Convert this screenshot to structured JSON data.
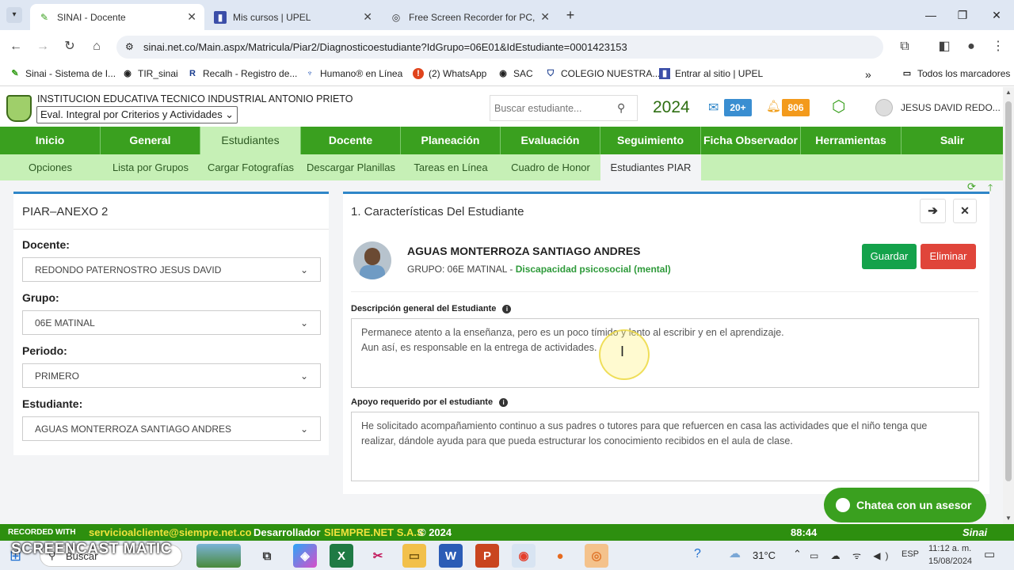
{
  "browser": {
    "tabs": [
      {
        "title": "SINAI - Docente",
        "active": true
      },
      {
        "title": "Mis cursos | UPEL",
        "active": false
      },
      {
        "title": "Free Screen Recorder for PC, M",
        "active": false
      }
    ],
    "url": "sinai.net.co/Main.aspx/Matricula/Piar2/Diagnosticoestudiante?IdGrupo=06E01&IdEstudiante=0001423153",
    "bookmarks": [
      "Sinai - Sistema de I...",
      "TIR_sinai",
      "Recalh - Registro de...",
      "Humano® en Línea",
      "(2) WhatsApp",
      "SAC",
      "COLEGIO NUESTRA...",
      "Entrar al sitio | UPEL"
    ],
    "all_bookmarks": "Todos los marcadores"
  },
  "header": {
    "institution": "INSTITUCION EDUCATIVA TECNICO INDUSTRIAL ANTONIO PRIETO",
    "mode_select": "Eval. Integral por Criterios y Actividades",
    "search_placeholder": "Buscar estudiante...",
    "year": "2024",
    "mail_badge": "20+",
    "notif_badge": "806",
    "user": "JESUS DAVID REDO..."
  },
  "menu": [
    "Inicio",
    "General",
    "Estudiantes",
    "Docente",
    "Planeación",
    "Evaluación",
    "Seguimiento",
    "Ficha Observador",
    "Herramientas",
    "Salir"
  ],
  "submenu": [
    "Opciones",
    "Lista por Grupos",
    "Cargar Fotografías",
    "Descargar Planillas",
    "Tareas en Línea",
    "Cuadro de Honor",
    "Estudiantes PIAR"
  ],
  "left_panel": {
    "title": "PIAR–ANEXO 2",
    "docente_label": "Docente:",
    "docente": "REDONDO PATERNOSTRO JESUS DAVID",
    "grupo_label": "Grupo:",
    "grupo": "06E MATINAL",
    "periodo_label": "Periodo:",
    "periodo": "PRIMERO",
    "estudiante_label": "Estudiante:",
    "estudiante": "AGUAS MONTERROZA SANTIAGO ANDRES"
  },
  "right_panel": {
    "title": "1. Características Del Estudiante",
    "student_name": "AGUAS MONTERROZA SANTIAGO ANDRES",
    "group_prefix": "GRUPO: 06E MATINAL - ",
    "disability": "Discapacidad psicosocial (mental)",
    "save": "Guardar",
    "delete": "Eliminar",
    "desc_label": "Descripción general del Estudiante",
    "desc_line1": "Permanece atento a la enseñanza, pero es un poco tímido y lento al escribir y en el aprendizaje.",
    "desc_line2": "Aun así, es responsable en la entrega de actividades.",
    "support_label": "Apoyo requerido por el estudiante",
    "support_line1": "He solicitado acompañamiento continuo a sus padres o tutores para que refuercen en casa las actividades que el niño tenga que",
    "support_line2": "realizar, dándole ayuda para que pueda estructurar los conocimiento recibidos en el aula de clase."
  },
  "chat": "Chatea con un asesor",
  "footer": {
    "recorded": "RECORDED WITH",
    "email": "servicioalcliente@siempre.net.co",
    "dev_label": "Desarrollador",
    "dev": "SIEMPRE.NET S.A.S",
    "copy": "© 2024",
    "counter": "88:44",
    "brand": "Sinai"
  },
  "watermark": "SCREENCAST MATIC",
  "taskbar": {
    "search": "Buscar",
    "temp": "31°C",
    "lang": "ESP",
    "time": "11:12 a. m.",
    "date": "15/08/2024"
  }
}
